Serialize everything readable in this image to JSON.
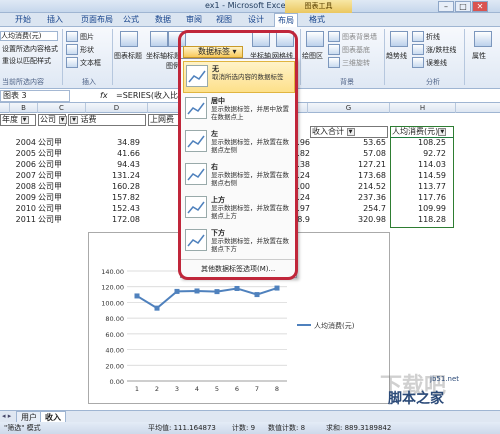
{
  "window": {
    "title": "ex1 - Microsoft Excel",
    "context_group": "图表工具",
    "min": "–",
    "max": "□",
    "close": "✕"
  },
  "tabs": [
    "开始",
    "插入",
    "页面布局",
    "公式",
    "数据",
    "审阅",
    "视图",
    "设计",
    "布局",
    "格式"
  ],
  "ribbon": {
    "current_selection": {
      "dropdown": "人均消费(元)",
      "items": [
        "设置所选内容格式",
        "重设以匹配样式"
      ],
      "group": "当前所选内容"
    },
    "insert": {
      "items": [
        "图片",
        "形状",
        "文本框"
      ],
      "group": "插入"
    },
    "labels": {
      "buttons": [
        "图表标题",
        "坐标轴标题",
        "图例"
      ],
      "active_dropdown": "数据标签",
      "right_buttons": [
        "坐标轴",
        "网格线"
      ]
    },
    "background": {
      "items": [
        "图表背景墙",
        "图表基底",
        "三维旋转"
      ],
      "plot_area": "绘图区",
      "group": "背景"
    },
    "analysis": {
      "items": [
        "折线",
        "涨/跌柱线",
        "误差线"
      ],
      "trendline": "趋势线",
      "group": "分析"
    },
    "properties": {
      "label": "属性"
    }
  },
  "formula_bar": {
    "name_box": "图表 3",
    "fx": "fx",
    "formula": "=SERIES(收入比"
  },
  "columns": [
    "B",
    "C",
    "D",
    "",
    "G",
    "H"
  ],
  "table": {
    "headers": [
      "年度",
      "公司",
      "话费",
      "上网费",
      "收入合计",
      "人均消费(元)"
    ],
    "rows": [
      {
        "year": "2004",
        "company": "公司甲",
        "phone": "34.89",
        "e": "3.96",
        "total": "53.65",
        "avg": "108.25"
      },
      {
        "year": "2005",
        "company": "公司甲",
        "phone": "41.66",
        "e": "3.82",
        "total": "57.08",
        "avg": "92.72"
      },
      {
        "year": "2006",
        "company": "公司甲",
        "phone": "94.43",
        "e": "8.38",
        "total": "127.21",
        "avg": "114.03"
      },
      {
        "year": "2007",
        "company": "公司甲",
        "phone": "131.24",
        "e": "1.24",
        "total": "173.68",
        "avg": "114.59"
      },
      {
        "year": "2008",
        "company": "公司甲",
        "phone": "160.28",
        "e": "4.00",
        "total": "214.52",
        "avg": "113.77"
      },
      {
        "year": "2009",
        "company": "公司甲",
        "phone": "157.82",
        "e": "1.24",
        "total": "237.36",
        "avg": "117.76"
      },
      {
        "year": "2010",
        "company": "公司甲",
        "phone": "152.43",
        "e": "4.97",
        "total": "254.7",
        "avg": "109.99"
      },
      {
        "year": "2011",
        "company": "公司甲",
        "phone": "172.08",
        "e": "28.9",
        "total": "320.98",
        "avg": "118.28"
      }
    ]
  },
  "menu": {
    "title": "数据标签",
    "items": [
      {
        "title": "无",
        "desc": "取消所选内容的数据标签"
      },
      {
        "title": "居中",
        "desc": "显示数据标签，并居中放置在数据点上"
      },
      {
        "title": "左",
        "desc": "显示数据标签，并放置在数据点左侧"
      },
      {
        "title": "右",
        "desc": "显示数据标签，并放置在数据点右侧"
      },
      {
        "title": "上方",
        "desc": "显示数据标签，并放置在数据点上方"
      },
      {
        "title": "下方",
        "desc": "显示数据标签，并放置在数据点下方"
      }
    ],
    "more": "其他数据标签选项(M)..."
  },
  "chart_data": {
    "type": "line",
    "categories": [
      "1",
      "2",
      "3",
      "4",
      "5",
      "6",
      "7",
      "8"
    ],
    "series": [
      {
        "name": "人均消费(元)",
        "values": [
          108.25,
          92.72,
          114.03,
          114.59,
          113.77,
          117.76,
          109.99,
          118.28
        ],
        "color": "#4f81bd"
      }
    ],
    "yticks": [
      "0.00",
      "20.00",
      "40.00",
      "60.00",
      "80.00",
      "100.00",
      "120.00",
      "140.00"
    ],
    "ylim": [
      0,
      140
    ],
    "grid": true,
    "legend": "right"
  },
  "sheet_tabs": [
    "用户",
    "收入"
  ],
  "status": {
    "mode": "\"筛选\" 模式",
    "avg": "平均值: 111.164873",
    "count": "计数: 9",
    "numcount": "数值计数: 8",
    "sum": "求和: 889.3189842"
  },
  "watermark": {
    "big": "下载吧",
    "site": "脚本之家",
    "url": "jb51.net"
  }
}
